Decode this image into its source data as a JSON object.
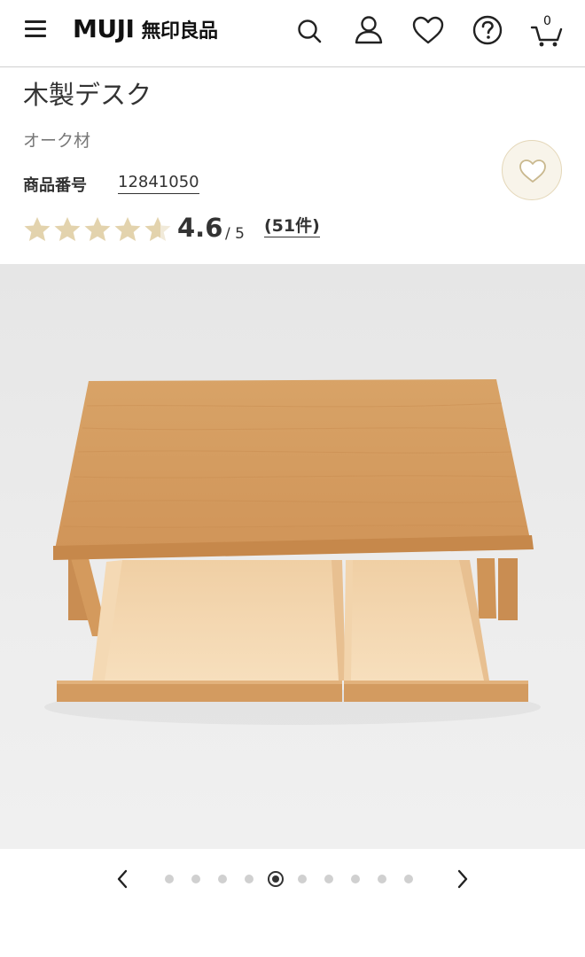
{
  "header": {
    "logo_latin": "MUJI",
    "logo_japanese": "無印良品",
    "cart_count": "0",
    "icons": [
      "menu-icon",
      "search-icon",
      "user-icon",
      "heart-icon",
      "help-icon",
      "cart-icon"
    ]
  },
  "product": {
    "title": "木製デスク",
    "material": "オーク材",
    "product_no_label": "商品番号",
    "product_no": "12841050",
    "rating": "4.6",
    "rating_max": "/ 5",
    "rating_value": 4.6,
    "review_count": "(51件)"
  },
  "gallery": {
    "image_count": 10,
    "active_index": 4
  },
  "colors": {
    "text": "#333333",
    "star": "#e3d3ad",
    "favorite_bg": "#f8f4ea",
    "favorite_border": "#e4d7b8",
    "desk_wood": "#d59a5e",
    "drawer_inner": "#f3d6b0"
  }
}
